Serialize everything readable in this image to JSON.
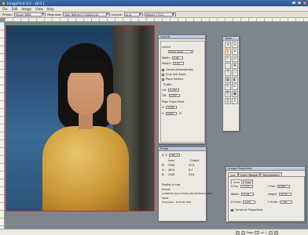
{
  "window": {
    "title": "ImagePrint 8.0 - v8.0.1",
    "controls": [
      "_",
      "□",
      "×"
    ]
  },
  "menu": [
    "File",
    "Edit",
    "Image",
    "View",
    "Help"
  ],
  "toolbar": {
    "printer_label": "Printer:",
    "printer_value": "Epson 3880",
    "page_label": "Page size:",
    "page_value": "User Defined 13.00x22.00",
    "layout_label": "Layout:",
    "layout_value": "As is",
    "media_value": "Hahnle 17x22"
  },
  "layout_panel": {
    "title": "Layout",
    "layout_label": "Layout",
    "layout_value": "Photo Sizes",
    "width_label": "Width:",
    "width_value": "0.00",
    "height_label": "Height:",
    "height_value": "0.00",
    "center_label": "Center Automatically",
    "crop_label": "Crop and Zoom",
    "place_holders_label": "Place Holders",
    "gutter_label": "Gutter",
    "lr_label": "L/R:",
    "lr_value": "0.250",
    "tb_label": "T/B:",
    "tb_value": "0.250",
    "origin_label": "Page Origin Point",
    "x_label": "X:",
    "x_value": "0.000",
    "y_label": "Y:",
    "y_value": "0.000"
  },
  "tools_panel": {
    "title": "Tools",
    "icons": [
      "zoom-in-icon",
      "zoom-out-icon",
      "hand-icon",
      "crop-icon",
      "rotate-icon",
      "flip-icon",
      "select-icon",
      "move-icon",
      "text-icon",
      "frame-icon",
      "grid-icon",
      "color-icon",
      "eyedropper-icon",
      "brush-icon",
      "stamp-icon",
      "clip-icon",
      "print-icon",
      "info-icon"
    ],
    "glyphs": [
      "⊕",
      "⊖",
      "✋",
      "⌗",
      "↻",
      "⇄",
      "⬚",
      "✥",
      "T",
      "▭",
      "▦",
      "◐",
      "✎",
      "✏",
      "⎘",
      "▣",
      "⎙",
      "ℹ"
    ]
  },
  "probe_panel": {
    "title": "Probe",
    "coord_label": "X, Y:",
    "coord_value": "181, 2",
    "input_header": "Input",
    "output_header": "Output",
    "rows": [
      {
        "ch": "R:",
        "input": "5590",
        "output": "47.8"
      },
      {
        "ch": "G:",
        "input": "4024",
        "output": "6.4"
      },
      {
        "ch": "B:",
        "input": "2209",
        "output": "59.6"
      }
    ],
    "profiles_title": "Profiles In Use",
    "printer_label": "Printer",
    "printer_profile": "ws3880HH_EpsonHotPressBrightUltraInk_PKV",
    "input_label": "Input",
    "input_profile": "Embedded - ProPhoto RGB"
  },
  "props_panel": {
    "title": "Image Properties",
    "tabs": [
      "Size",
      "Crop / Repeat",
      "Transparency"
    ],
    "subtabs": [
      "Scale",
      "Crop"
    ],
    "xpos_label": "X Pos:",
    "xpos_value": "-0.337",
    "ypos_label": "Y Pos:",
    "ypos_value": "0.000",
    "width_label": "Width:",
    "width_value": "13.58",
    "height_label": "Height:",
    "height_value": "22.00",
    "xscale_label": "X Scale:",
    "xscale_value": "1.9%",
    "yscale_label": "Y Scale:",
    "yscale_value": "1.9%",
    "constrain_label": "Constrain Proportions"
  },
  "status": {
    "zoom": "",
    "page_label": "Page",
    "page_value": "1",
    "of_label": "of",
    "total_pages": "1"
  }
}
